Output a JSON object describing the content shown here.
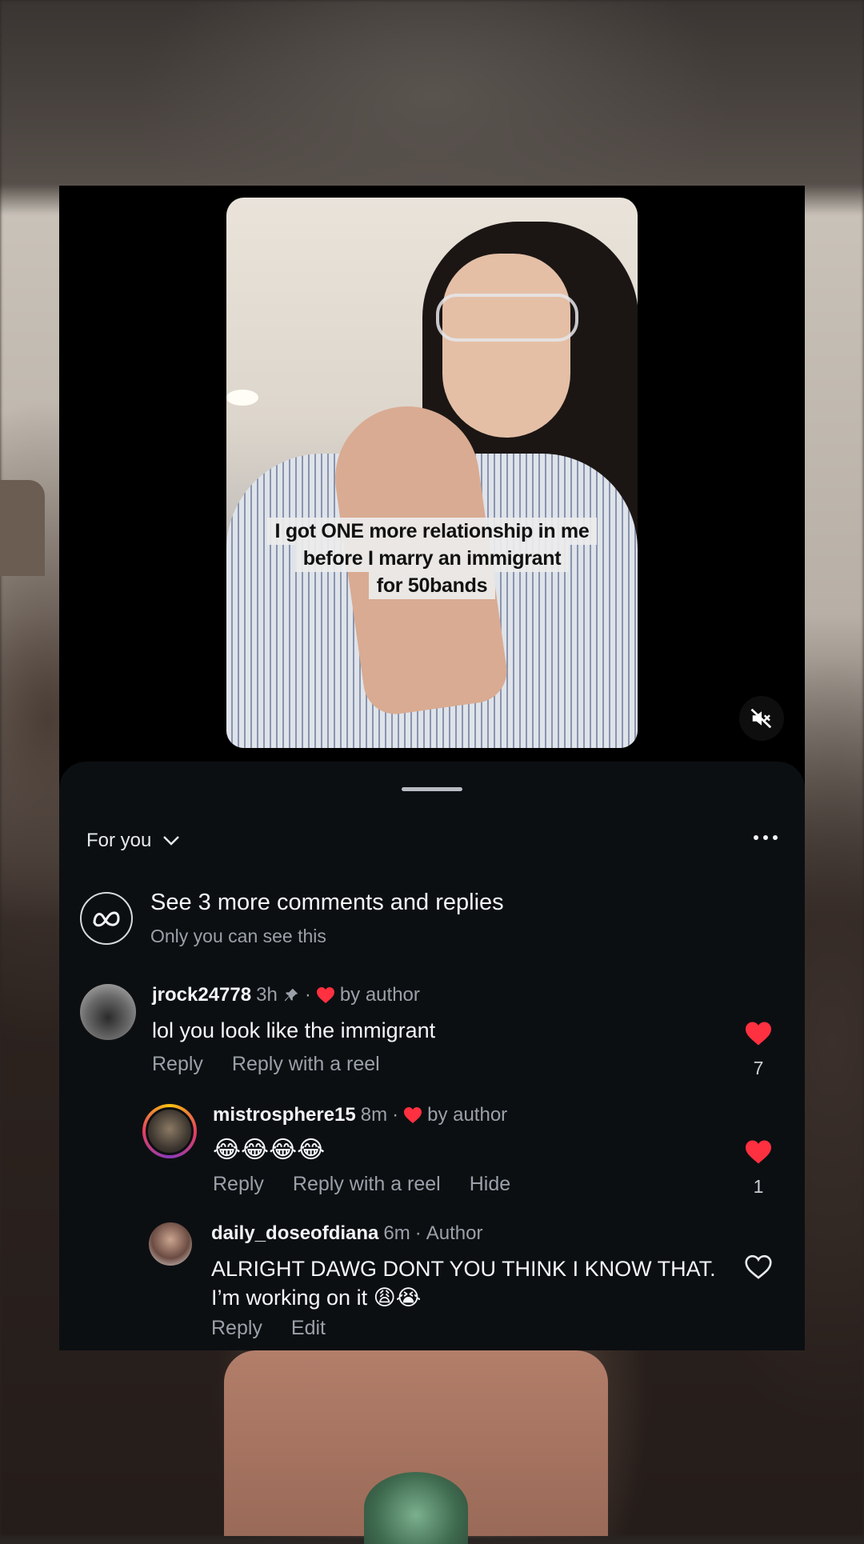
{
  "video": {
    "caption_lines": [
      "I got ONE more relationship in me",
      "before I marry an immigrant",
      "for 50bands"
    ],
    "mute_icon": "speaker-muted-icon"
  },
  "comments_sheet": {
    "sort_label": "For you",
    "meta_banner": {
      "title": "See 3 more comments and replies",
      "subtitle": "Only you can see this",
      "icon": "meta-logo-icon"
    },
    "comments": [
      {
        "username": "jrock24778",
        "time": "3h",
        "pinned": true,
        "liked_by_author": "by author",
        "text": "lol you look like the immigrant",
        "actions": [
          "Reply",
          "Reply with a reel"
        ],
        "likes": "7",
        "liked": true
      },
      {
        "username": "mistrosphere15",
        "time": "8m",
        "liked_by_author": "by author",
        "text": "😂😂😂😂",
        "actions": [
          "Reply",
          "Reply with a reel",
          "Hide"
        ],
        "likes": "1",
        "liked": true
      },
      {
        "username": "daily_doseofdiana",
        "time": "6m",
        "badge": "Author",
        "text": "ALRIGHT DAWG DONT YOU THINK I KNOW THAT. I’m working on it 😩😭",
        "actions": [
          "Reply",
          "Edit"
        ],
        "liked": false
      }
    ]
  },
  "colors": {
    "sheet_bg": "#0c0f12",
    "heart_red": "#ff3040",
    "muted_text": "#9aa1a9"
  }
}
